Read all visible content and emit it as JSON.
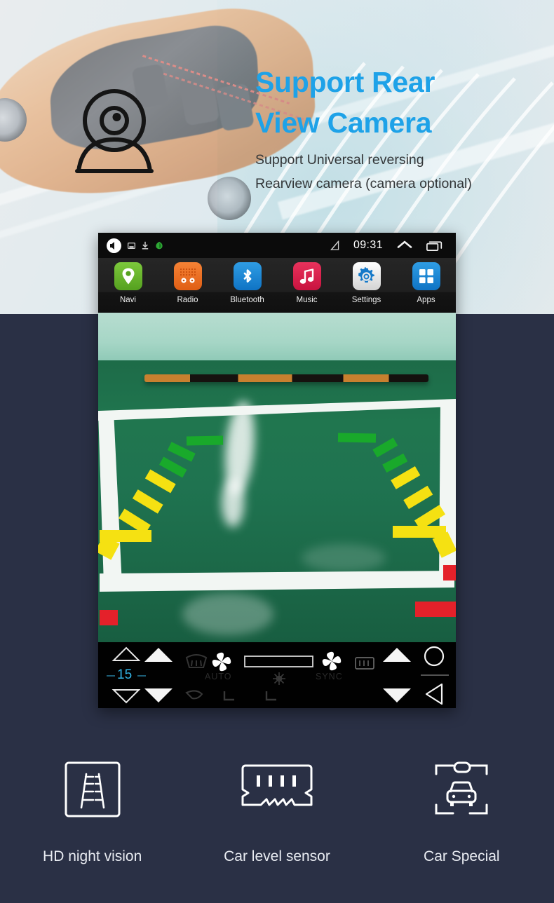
{
  "banner": {
    "headline_line1": "Support Rear",
    "headline_line2": "View Camera",
    "sub_line1": "Support Universal reversing",
    "sub_line2": "Rearview camera (camera optional)",
    "headline_color": "#1ea2e8",
    "sub_color": "#333638",
    "camera_icon": "webcam-icon"
  },
  "device": {
    "statusbar": {
      "speaker_icon": "speaker-icon",
      "screenshot_icon": "screenshot-icon",
      "download_icon": "download-icon",
      "green_icon": "green-app-icon",
      "signal_icon": "signal-off-icon",
      "time": "09:31",
      "expand_icon": "chevron-up-icon",
      "recents_icon": "recents-icon"
    },
    "apps": [
      {
        "label": "Navi",
        "icon": "map-pin-icon",
        "color": "#63b22a"
      },
      {
        "label": "Radio",
        "icon": "radio-icon",
        "color": "#ec6a1f"
      },
      {
        "label": "Bluetooth",
        "icon": "bluetooth-icon",
        "color": "#1786d4"
      },
      {
        "label": "Music",
        "icon": "music-note-icon",
        "color": "#d9234f"
      },
      {
        "label": "Settings",
        "icon": "gear-icon",
        "color": "#e9e9e9"
      },
      {
        "label": "Apps",
        "icon": "grid-apps-icon",
        "color": "#1786d4"
      }
    ],
    "camera_view": {
      "description": "rear-view camera feed of green floor parking bay",
      "guideline_colors": {
        "near": "#e4212a",
        "mid": "#f5e112",
        "far": "#19a92b"
      },
      "lane_line_color": "#f2f6f3",
      "floor_color": "#1f7350",
      "wall_color": "#a6d6c6"
    },
    "climate": {
      "temperature": "15",
      "temperature_color": "#33b6e8",
      "auto_label": "AUTO",
      "sync_label": "SYNC",
      "icons": [
        "temp-up-outline-icon",
        "temp-down-outline-icon",
        "fan-up-icon",
        "fan-down-icon",
        "front-defrost-icon",
        "fan-blade-left-icon",
        "level-bar-icon",
        "snowflake-icon",
        "fan-blade-right-icon",
        "rear-defrost-icon",
        "volume-up-icon",
        "volume-down-icon",
        "home-circle-icon",
        "back-triangle-icon",
        "seat-heat-left-icon",
        "seat-heat-right-icon",
        "recirculate-icon"
      ]
    }
  },
  "features": [
    {
      "label": "HD night vision",
      "icon": "parking-guide-lines-icon"
    },
    {
      "label": "Car level sensor",
      "icon": "level-sensor-module-icon"
    },
    {
      "label": "Car Special",
      "icon": "car-front-frame-icon"
    }
  ]
}
